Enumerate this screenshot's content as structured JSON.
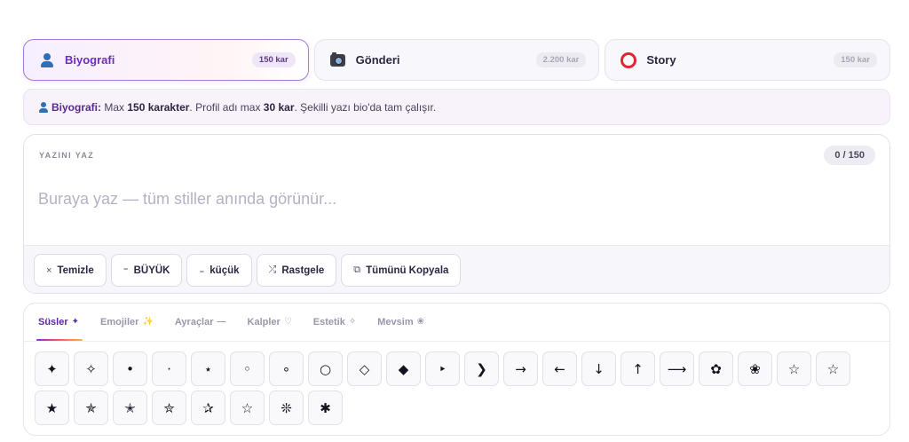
{
  "platform_tabs": [
    {
      "label": "Biyografi",
      "limit": "150 kar",
      "icon": "user-icon",
      "active": true
    },
    {
      "label": "Gönderi",
      "limit": "2.200 kar",
      "icon": "camera-icon",
      "active": false
    },
    {
      "label": "Story",
      "limit": "150 kar",
      "icon": "ring-icon",
      "active": false
    }
  ],
  "info": {
    "label": "Biyografi:",
    "t1": " Max ",
    "max_chars": "150 karakter",
    "t2": ". Profil adı max ",
    "name_max": "30 kar",
    "t3": ". Şekilli yazı bio'da tam çalışır."
  },
  "editor": {
    "label": "YAZINI YAZ",
    "counter": "0 / 150",
    "placeholder": "Buraya yaz — tüm stiller anında görünür..."
  },
  "toolbar": [
    {
      "icon": "×",
      "label": "Temizle",
      "name": "clear-button"
    },
    {
      "icon": "⁼",
      "label": "BÜYÜK",
      "name": "uppercase-button"
    },
    {
      "icon": "₌",
      "label": "küçük",
      "name": "lowercase-button"
    },
    {
      "icon": "⤮",
      "label": "Rastgele",
      "name": "random-button"
    },
    {
      "icon": "⧉",
      "label": "Tümünü Kopyala",
      "name": "copy-all-button"
    }
  ],
  "categories": [
    {
      "label": "Süsler",
      "icon": "✦",
      "active": true
    },
    {
      "label": "Emojiler",
      "icon": "✨",
      "active": false
    },
    {
      "label": "Ayraçlar",
      "icon": "—",
      "active": false
    },
    {
      "label": "Kalpler",
      "icon": "♡",
      "active": false
    },
    {
      "label": "Estetik",
      "icon": "✧",
      "active": false
    },
    {
      "label": "Mevsim",
      "icon": "❀",
      "active": false
    }
  ],
  "symbols": [
    "✦",
    "✧",
    "•",
    "·",
    "⋆",
    "◦",
    "∘",
    "○",
    "◇",
    "◆",
    "‣",
    "❯",
    "→",
    "←",
    "↓",
    "↑",
    "⟶",
    "✿",
    "❀",
    "☆",
    "☆",
    "★",
    "✯",
    "✭",
    "✮",
    "✰",
    "☆",
    "❊",
    "✱"
  ],
  "colors": {
    "accent": "#6d2ebd",
    "tab_border": "#a679e0",
    "info_bg": "#f8f2fb"
  }
}
